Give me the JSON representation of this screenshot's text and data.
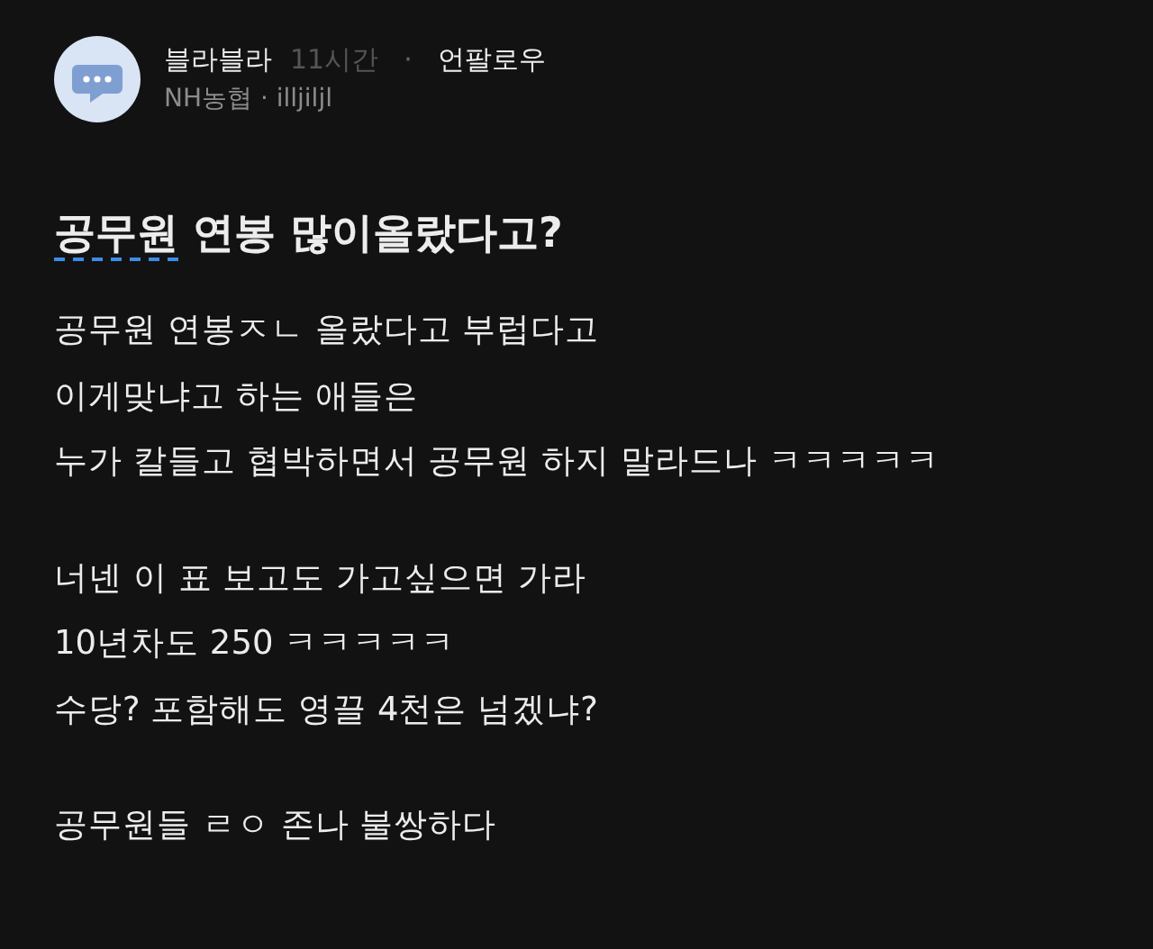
{
  "post": {
    "author": "블라블라",
    "time": "11시간",
    "separator": "·",
    "follow": "언팔로우",
    "company_line": "NH농협 · illjiljl",
    "title": {
      "link": "공무원",
      "rest": " 연봉 많이올랐다고?"
    },
    "paragraphs": [
      [
        "공무원 연봉ㅈㄴ 올랐다고 부럽다고",
        "이게맞냐고 하는 애들은",
        "누가 칼들고 협박하면서 공무원 하지 말라드나 ㅋㅋㅋㅋㅋ"
      ],
      [
        "너넨 이 표 보고도 가고싶으면 가라",
        "10년차도 250  ㅋㅋㅋㅋㅋ",
        "수당? 포함해도 영끌 4천은 넘겠냐?"
      ],
      [
        "공무원들 ㄹㅇ 존나 불쌍하다"
      ]
    ]
  }
}
